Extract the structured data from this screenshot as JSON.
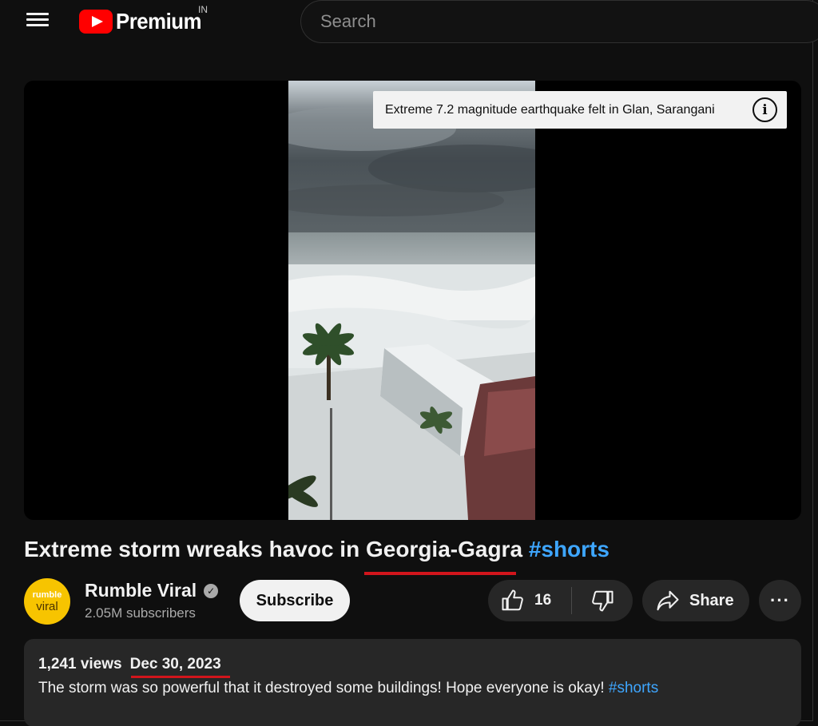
{
  "header": {
    "logo_text": "Premium",
    "country_code": "IN",
    "search_placeholder": "Search"
  },
  "player": {
    "info_panel_text": "Extreme 7.2 magnitude earthquake felt in Glan, Sarangani"
  },
  "video": {
    "title": "Extreme storm wreaks havoc in Georgia-Gagra",
    "title_hashtag": "#shorts"
  },
  "channel": {
    "avatar_line1": "rumble",
    "avatar_line2": "viral",
    "name": "Rumble Viral",
    "subscribers": "2.05M subscribers",
    "subscribe_label": "Subscribe"
  },
  "actions": {
    "like_count": "16",
    "share_label": "Share",
    "more_label": "···"
  },
  "description": {
    "views": "1,241 views",
    "date": "Dec 30, 2023",
    "text": "The storm was so powerful that it destroyed some buildings! Hope everyone is okay! ",
    "hashtag": "#shorts"
  },
  "colors": {
    "background": "#0f0f0f",
    "brand_red": "#ff0000",
    "link_blue": "#3ea6ff",
    "annotation_red": "#d2151c",
    "button_bg": "#272727"
  }
}
